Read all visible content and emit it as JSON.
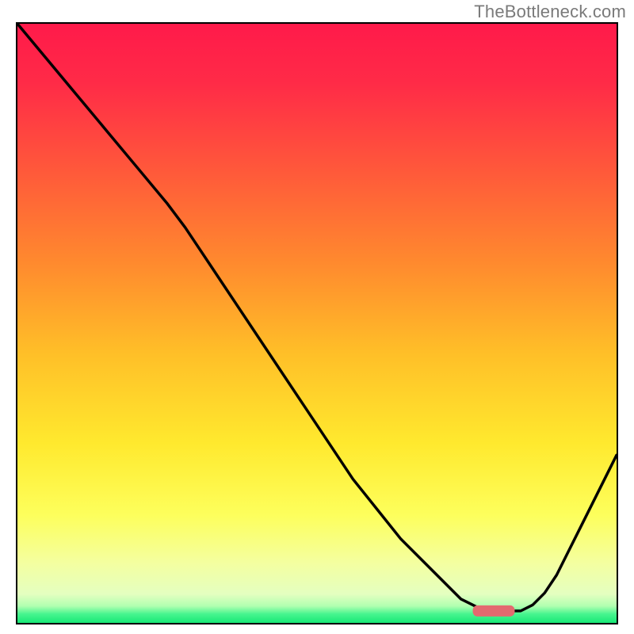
{
  "watermark": "TheBottleneck.com",
  "colors": {
    "gradient_stops": [
      {
        "offset": 0.0,
        "color": "#ff1a4a"
      },
      {
        "offset": 0.1,
        "color": "#ff2b47"
      },
      {
        "offset": 0.25,
        "color": "#ff5a3a"
      },
      {
        "offset": 0.4,
        "color": "#ff8a2e"
      },
      {
        "offset": 0.55,
        "color": "#ffbf28"
      },
      {
        "offset": 0.7,
        "color": "#ffe92e"
      },
      {
        "offset": 0.82,
        "color": "#fdff5c"
      },
      {
        "offset": 0.9,
        "color": "#f4ffa0"
      },
      {
        "offset": 0.952,
        "color": "#e4ffc0"
      },
      {
        "offset": 0.972,
        "color": "#b0ffb0"
      },
      {
        "offset": 0.985,
        "color": "#48f58f"
      },
      {
        "offset": 1.0,
        "color": "#18e876"
      }
    ],
    "curve": "#000000",
    "marker": "#e36a6f",
    "border": "#000000",
    "watermark": "#7a7a7a"
  },
  "chart_data": {
    "type": "line",
    "title": "",
    "xlabel": "",
    "ylabel": "",
    "xlim": [
      0,
      100
    ],
    "ylim": [
      0,
      100
    ],
    "grid": false,
    "x": [
      0,
      5,
      10,
      15,
      20,
      25,
      28,
      32,
      36,
      40,
      44,
      48,
      52,
      56,
      60,
      64,
      68,
      72,
      74,
      76,
      78,
      80,
      82,
      84,
      86,
      88,
      90,
      92,
      94,
      96,
      98,
      100
    ],
    "values": [
      100,
      94,
      88,
      82,
      76,
      70,
      66,
      60,
      54,
      48,
      42,
      36,
      30,
      24,
      19,
      14,
      10,
      6,
      4,
      3,
      2,
      2,
      2,
      2,
      3,
      5,
      8,
      12,
      16,
      20,
      24,
      28
    ],
    "marker_segment": {
      "x_start": 76,
      "x_end": 83,
      "y": 2
    },
    "annotations": []
  }
}
